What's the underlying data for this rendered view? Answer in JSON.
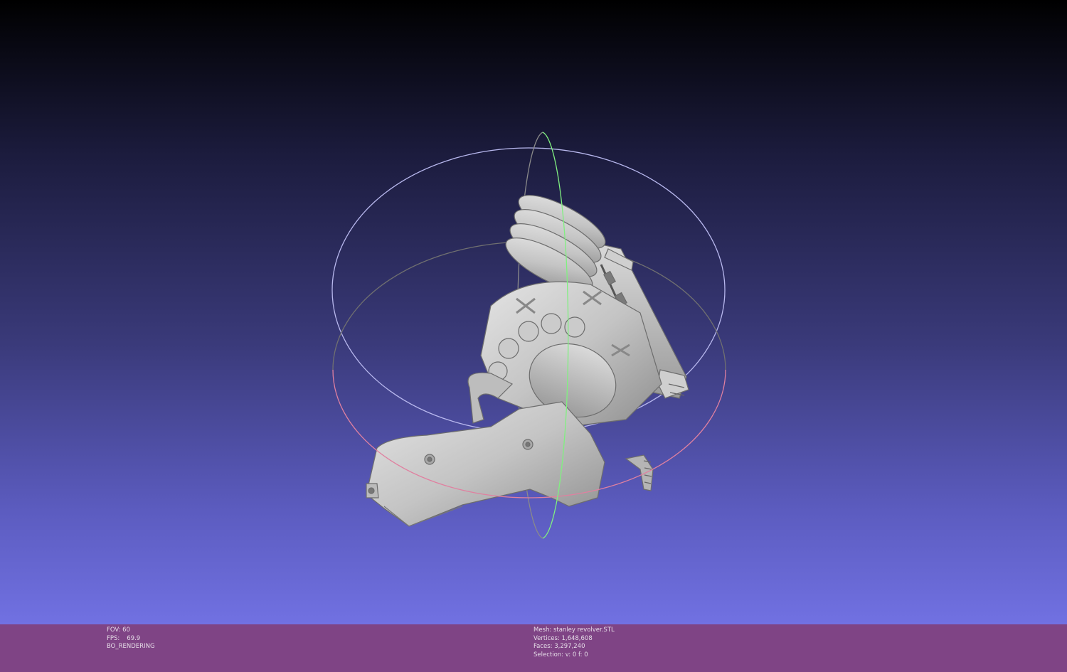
{
  "app": {
    "accent_colors": {
      "background_top": "#000000",
      "background_bottom": "#7171e2",
      "info_bar": "#7f4485",
      "mesh": "#c8c8c8",
      "trackball_x": "#e080a0",
      "trackball_y": "#80f080",
      "trackball_z": "#c0c0ff"
    }
  },
  "viewport": {
    "object": "revolver-mesh",
    "icons": [
      "trackball-gizmo"
    ]
  },
  "info_left": {
    "fov_label": "FOV:",
    "fov_value": "60",
    "fps_label": "FPS:",
    "fps_value": "69.9",
    "render_mode": "BO_RENDERING"
  },
  "info_right": {
    "mesh": "Mesh: stanley revolver.STL",
    "vertices": "Vertices: 1,648,608",
    "faces": "Faces: 3,297,240",
    "selection": "Selection: v: 0 f: 0"
  }
}
